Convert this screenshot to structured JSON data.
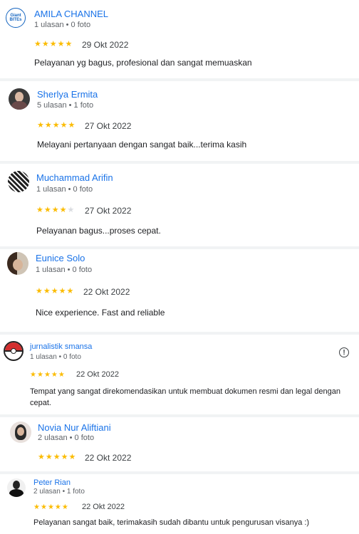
{
  "reviews": [
    {
      "name": "AMILA CHANNEL",
      "meta": "1 ulasan • 0 foto",
      "rating": 5,
      "date": "29 Okt 2022",
      "text": "Pelayanan yg bagus, profesional dan sangat memuaskan",
      "avatar_icon": "amila-logo",
      "avatar_logo_text": "Giant BITEs"
    },
    {
      "name": "Sherlya Ermita",
      "meta": "5 ulasan • 1 foto",
      "rating": 5,
      "date": "27 Okt 2022",
      "text": "Melayani pertanyaan dengan sangat baik...terima kasih",
      "avatar_icon": "user-photo"
    },
    {
      "name": "Muchammad Arifin",
      "meta": "1 ulasan • 0 foto",
      "rating": 4,
      "date": "27 Okt 2022",
      "text": "Pelayanan bagus...proses cepat.",
      "avatar_icon": "user-photo"
    },
    {
      "name": "Eunice Solo",
      "meta": "1 ulasan • 0 foto",
      "rating": 5,
      "date": "22 Okt 2022",
      "text": "Nice experience. Fast and reliable",
      "avatar_icon": "user-photo"
    },
    {
      "name": "jurnalistik smansa",
      "meta": "1 ulasan • 0 foto",
      "rating": 5,
      "date": "22 Okt 2022",
      "text": "Tempat yang sangat direkomendasikan untuk membuat dokumen resmi dan legal dengan cepat.",
      "avatar_icon": "pokeball-logo",
      "has_info_icon": true
    },
    {
      "name": "Novia Nur Aliftiani",
      "meta": "2 ulasan • 0 foto",
      "rating": 5,
      "date": "22 Okt 2022",
      "text": "",
      "avatar_icon": "user-photo"
    },
    {
      "name": "Peter Rian",
      "meta": "2 ulasan • 1 foto",
      "rating": 5,
      "date": "22 Okt 2022",
      "text": "Pelayanan sangat baik, terimakasih sudah dibantu untuk pengurusan visanya :)",
      "avatar_icon": "user-photo"
    }
  ],
  "colors": {
    "name": "#1a73e8",
    "star": "#fbbc04",
    "star_empty": "#dadce0"
  }
}
